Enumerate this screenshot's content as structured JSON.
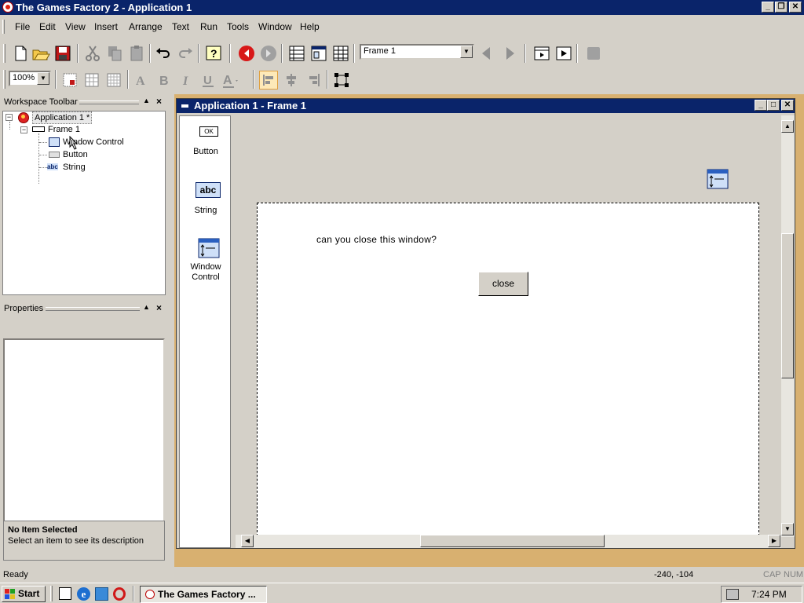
{
  "window": {
    "title": "The Games Factory 2 - Application 1",
    "min": "_",
    "restore": "❐",
    "close": "✕"
  },
  "menu": [
    "File",
    "Edit",
    "View",
    "Insert",
    "Arrange",
    "Text",
    "Run",
    "Tools",
    "Window",
    "Help"
  ],
  "toolbar": {
    "frame_select": "Frame 1",
    "zoom_select": "100%"
  },
  "workspace": {
    "title": "Workspace Toolbar",
    "app_node": "Application 1 *",
    "frame_node": "Frame 1",
    "children": [
      "Window Control",
      "Button",
      "String"
    ]
  },
  "properties": {
    "title": "Properties",
    "no_item_title": "No Item Selected",
    "no_item_desc": "Select an item to see its description"
  },
  "child_window": {
    "title": "Application 1 - Frame 1"
  },
  "object_palette": [
    {
      "label": "Button",
      "icon": "ok-button-icon",
      "icon_text": "OK"
    },
    {
      "label": "String",
      "icon": "abc-string-icon",
      "icon_text": "abc"
    },
    {
      "label": "Window Control",
      "icon": "window-control-icon",
      "icon_text": ""
    }
  ],
  "frame_canvas": {
    "text": "can you close this window?",
    "button_label": "close"
  },
  "statusbar": {
    "text": "Ready",
    "coords": "-240, -104",
    "cap": "CAP",
    "num": "NUM"
  },
  "taskbar": {
    "start": "Start",
    "task": "The Games Factory ...",
    "time": "7:24 PM"
  },
  "colors": {
    "titlebar": "#0a246a",
    "mdi_background": "#d8b070",
    "face": "#d4d0c8"
  }
}
